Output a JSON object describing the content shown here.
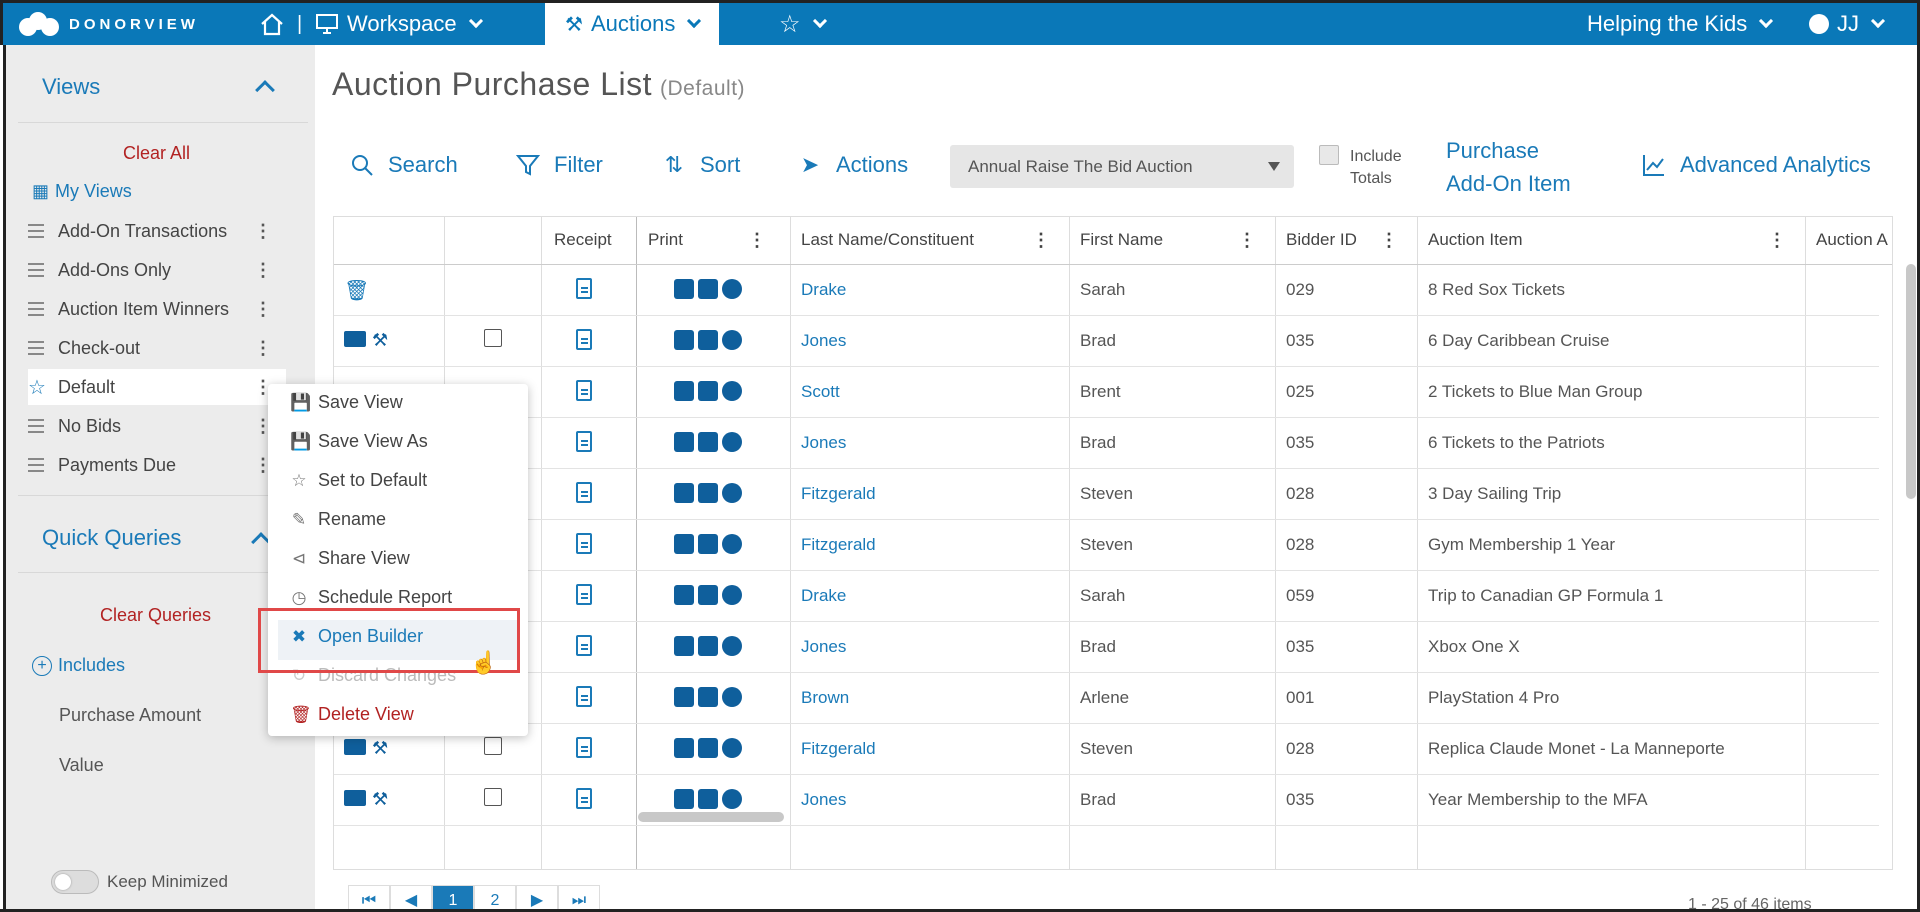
{
  "topnav": {
    "logo_text": "DONORVIEW",
    "sep": "|",
    "workspace": "Workspace",
    "auctions": "Auctions",
    "org": "Helping the Kids",
    "user": "JJ"
  },
  "sidebar": {
    "views_title": "Views",
    "clear_all": "Clear All",
    "my_views": "My Views",
    "views": [
      {
        "label": "Add-On Transactions"
      },
      {
        "label": "Add-Ons Only"
      },
      {
        "label": "Auction Item Winners"
      },
      {
        "label": "Check-out"
      },
      {
        "label": "Default",
        "selected": true
      },
      {
        "label": "No Bids"
      },
      {
        "label": "Payments Due"
      }
    ],
    "quick_queries_title": "Quick Queries",
    "clear_queries": "Clear Queries",
    "includes": "Includes",
    "queries": [
      "Purchase Amount",
      "Value"
    ],
    "keep_minimized": "Keep Minimized"
  },
  "main": {
    "title": "Auction Purchase List",
    "subtitle": "(Default)",
    "toolbar": {
      "search": "Search",
      "filter": "Filter",
      "sort": "Sort",
      "actions": "Actions",
      "auction_select": "Annual Raise The Bid Auction",
      "include_totals_line1": "Include",
      "include_totals_line2": "Totals",
      "purchase_line1": "Purchase",
      "purchase_line2": "Add-On Item",
      "advanced_analytics": "Advanced Analytics"
    }
  },
  "grid": {
    "columns": [
      "",
      "",
      "Receipt",
      "Print",
      "Last Name/Constituent",
      "First Name",
      "Bidder ID",
      "Auction Item",
      "Auction A"
    ],
    "rows": [
      {
        "last": "Drake",
        "first": "Sarah",
        "bidder": "029",
        "item": "8 Red Sox Tickets"
      },
      {
        "last": "Jones",
        "first": "Brad",
        "bidder": "035",
        "item": "6 Day Caribbean Cruise"
      },
      {
        "last": "Scott",
        "first": "Brent",
        "bidder": "025",
        "item": "2 Tickets to Blue Man Group"
      },
      {
        "last": "Jones",
        "first": "Brad",
        "bidder": "035",
        "item": "6 Tickets to the Patriots"
      },
      {
        "last": "Fitzgerald",
        "first": "Steven",
        "bidder": "028",
        "item": "3 Day Sailing Trip"
      },
      {
        "last": "Fitzgerald",
        "first": "Steven",
        "bidder": "028",
        "item": "Gym Membership 1 Year"
      },
      {
        "last": "Drake",
        "first": "Sarah",
        "bidder": "059",
        "item": "Trip to Canadian GP Formula 1"
      },
      {
        "last": "Jones",
        "first": "Brad",
        "bidder": "035",
        "item": "Xbox One X"
      },
      {
        "last": "Brown",
        "first": "Arlene",
        "bidder": "001",
        "item": "PlayStation 4 Pro"
      },
      {
        "last": "Fitzgerald",
        "first": "Steven",
        "bidder": "028",
        "item": "Replica Claude Monet - La Manneporte"
      },
      {
        "last": "Jones",
        "first": "Brad",
        "bidder": "035",
        "item": "Year Membership to the MFA"
      }
    ],
    "pager": {
      "page1": "1",
      "page2": "2",
      "info": "1 - 25 of 46 items"
    }
  },
  "context_menu": {
    "items": [
      "Save View",
      "Save View As",
      "Set to Default",
      "Rename",
      "Share View",
      "Schedule Report",
      "Open Builder",
      "Discard Changes",
      "Delete View"
    ]
  }
}
